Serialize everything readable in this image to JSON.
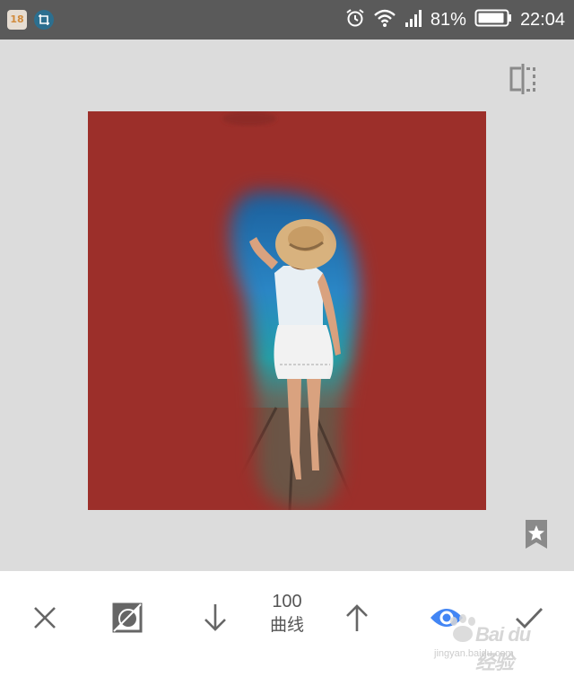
{
  "status_bar": {
    "notification_app_badge": "18",
    "battery_percent": "81%",
    "time": "22:04",
    "icons": [
      "calendar-app-icon",
      "photo-editor-app-icon",
      "alarm-icon",
      "wifi-icon",
      "signal-icon",
      "battery-icon"
    ]
  },
  "colors": {
    "mask_red": "#9c2f2a",
    "accent_blue": "#4285f4",
    "toolbar_icon_gray": "#666666",
    "status_bar_bg": "#5a5a5a",
    "canvas_bg": "#dcdcdc"
  },
  "editor": {
    "compare_icon": "compare-split-icon",
    "bookmark_icon": "star-bookmark-icon"
  },
  "toolbar": {
    "cancel_icon": "close-icon",
    "invert_icon": "invert-mask-icon",
    "decrease_icon": "arrow-down-icon",
    "value": "100",
    "label": "曲线",
    "increase_icon": "arrow-up-icon",
    "show_mask_icon": "eye-icon",
    "apply_icon": "check-icon"
  },
  "watermark": {
    "brand": "Bai du 经验",
    "url": "jingyan.baidu.com"
  }
}
